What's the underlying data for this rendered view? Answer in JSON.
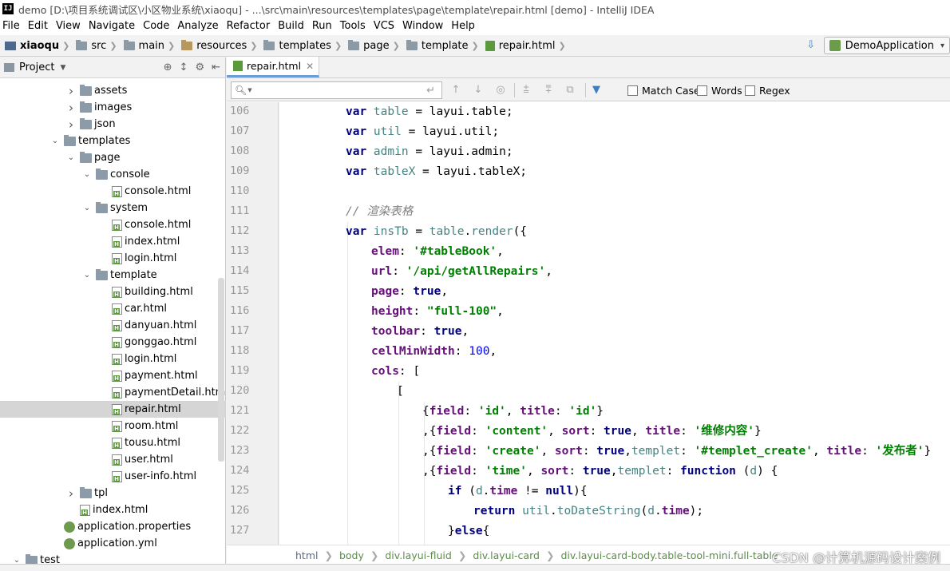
{
  "window": {
    "title": "demo [D:\\项目系统调试区\\小区物业系统\\xiaoqu] - ...\\src\\main\\resources\\templates\\page\\template\\repair.html [demo] - IntelliJ IDEA",
    "app_icon_text": "IJ"
  },
  "menu": [
    "File",
    "Edit",
    "View",
    "Navigate",
    "Code",
    "Analyze",
    "Refactor",
    "Build",
    "Run",
    "Tools",
    "VCS",
    "Window",
    "Help"
  ],
  "breadcrumb": [
    "xiaoqu",
    "src",
    "main",
    "resources",
    "templates",
    "page",
    "template",
    "repair.html"
  ],
  "run_config": "DemoApplication",
  "project_panel": {
    "title": "Project",
    "tree": [
      {
        "label": "assets",
        "depth": 5,
        "kind": "dir",
        "toggle": "closed"
      },
      {
        "label": "images",
        "depth": 5,
        "kind": "dir",
        "toggle": "closed"
      },
      {
        "label": "json",
        "depth": 5,
        "kind": "dir",
        "toggle": "closed"
      },
      {
        "label": "templates",
        "depth": 4,
        "kind": "dir",
        "toggle": "open"
      },
      {
        "label": "page",
        "depth": 5,
        "kind": "dir",
        "toggle": "open"
      },
      {
        "label": "console",
        "depth": 6,
        "kind": "dir",
        "toggle": "open"
      },
      {
        "label": "console.html",
        "depth": 7,
        "kind": "file",
        "toggle": ""
      },
      {
        "label": "system",
        "depth": 6,
        "kind": "dir",
        "toggle": "open"
      },
      {
        "label": "console.html",
        "depth": 7,
        "kind": "file",
        "toggle": ""
      },
      {
        "label": "index.html",
        "depth": 7,
        "kind": "file",
        "toggle": ""
      },
      {
        "label": "login.html",
        "depth": 7,
        "kind": "file",
        "toggle": ""
      },
      {
        "label": "template",
        "depth": 6,
        "kind": "dir",
        "toggle": "open"
      },
      {
        "label": "building.html",
        "depth": 7,
        "kind": "file",
        "toggle": ""
      },
      {
        "label": "car.html",
        "depth": 7,
        "kind": "file",
        "toggle": ""
      },
      {
        "label": "danyuan.html",
        "depth": 7,
        "kind": "file",
        "toggle": ""
      },
      {
        "label": "gonggao.html",
        "depth": 7,
        "kind": "file",
        "toggle": ""
      },
      {
        "label": "login.html",
        "depth": 7,
        "kind": "file",
        "toggle": ""
      },
      {
        "label": "payment.html",
        "depth": 7,
        "kind": "file",
        "toggle": ""
      },
      {
        "label": "paymentDetail.htm",
        "depth": 7,
        "kind": "file",
        "toggle": ""
      },
      {
        "label": "repair.html",
        "depth": 7,
        "kind": "file",
        "toggle": "",
        "selected": true
      },
      {
        "label": "room.html",
        "depth": 7,
        "kind": "file",
        "toggle": ""
      },
      {
        "label": "tousu.html",
        "depth": 7,
        "kind": "file",
        "toggle": ""
      },
      {
        "label": "user.html",
        "depth": 7,
        "kind": "file",
        "toggle": ""
      },
      {
        "label": "user-info.html",
        "depth": 7,
        "kind": "file",
        "toggle": ""
      },
      {
        "label": "tpl",
        "depth": 5,
        "kind": "dir",
        "toggle": "closed"
      },
      {
        "label": "index.html",
        "depth": 5,
        "kind": "file",
        "toggle": ""
      },
      {
        "label": "application.properties",
        "depth": 4,
        "kind": "prop",
        "toggle": ""
      },
      {
        "label": "application.yml",
        "depth": 4,
        "kind": "prop",
        "toggle": ""
      },
      {
        "label": "test",
        "depth": 2,
        "kind": "dir",
        "toggle": "open"
      }
    ]
  },
  "editor": {
    "tab": "repair.html",
    "find": {
      "placeholder": "",
      "match_case": "Match Case",
      "words": "Words",
      "regex": "Regex"
    },
    "lines": [
      {
        "n": "106",
        "fold": false
      },
      {
        "n": "107",
        "fold": false
      },
      {
        "n": "108",
        "fold": false
      },
      {
        "n": "109",
        "fold": false
      },
      {
        "n": "110",
        "fold": false
      },
      {
        "n": "111",
        "fold": false
      },
      {
        "n": "112",
        "fold": true
      },
      {
        "n": "113",
        "fold": false
      },
      {
        "n": "114",
        "fold": false
      },
      {
        "n": "115",
        "fold": false
      },
      {
        "n": "116",
        "fold": false
      },
      {
        "n": "117",
        "fold": false
      },
      {
        "n": "118",
        "fold": false
      },
      {
        "n": "119",
        "fold": true
      },
      {
        "n": "120",
        "fold": true
      },
      {
        "n": "121",
        "fold": false
      },
      {
        "n": "122",
        "fold": false
      },
      {
        "n": "123",
        "fold": false
      },
      {
        "n": "124",
        "fold": true
      },
      {
        "n": "125",
        "fold": true
      },
      {
        "n": "126",
        "fold": false
      },
      {
        "n": "127",
        "fold": true
      }
    ],
    "code_text": {
      "l106": [
        "var",
        " table",
        " = ",
        "layui",
        ".",
        "table",
        ";"
      ],
      "l107": [
        "var",
        " util",
        " = ",
        "layui",
        ".",
        "util",
        ";"
      ],
      "l108": [
        "var",
        " admin",
        " = ",
        "layui",
        ".",
        "admin",
        ";"
      ],
      "l109": [
        "var",
        " tableX",
        " = ",
        "layui",
        ".",
        "tableX",
        ";"
      ],
      "l111": "// 渲染表格",
      "l112": [
        "var",
        " insTb",
        " = ",
        "table",
        ".",
        "render",
        "({"
      ],
      "l113": [
        "elem",
        ": ",
        "'#tableBook'",
        ","
      ],
      "l114": [
        "url",
        ": ",
        "'/api/getAllRepairs'",
        ","
      ],
      "l115": [
        "page",
        ": ",
        "true",
        ","
      ],
      "l116": [
        "height",
        ": ",
        "\"full-100\"",
        ","
      ],
      "l117": [
        "toolbar",
        ": ",
        "true",
        ","
      ],
      "l118": [
        "cellMinWidth",
        ": ",
        "100",
        ","
      ],
      "l119": [
        "cols",
        ": ["
      ],
      "l120": "[",
      "l121": [
        "{",
        "field",
        ": ",
        "'id'",
        ", ",
        "title",
        ": ",
        "'id'",
        "}"
      ],
      "l122": [
        ",{",
        "field",
        ": ",
        "'content'",
        ", ",
        "sort",
        ": ",
        "true",
        ", ",
        "title",
        ": ",
        "'维修内容'",
        "}"
      ],
      "l123": [
        ",{",
        "field",
        ": ",
        "'create'",
        ", ",
        "sort",
        ": ",
        "true",
        ",",
        "templet",
        ": ",
        "'#templet_create'",
        ", ",
        "title",
        ": ",
        "'发布者'",
        "}"
      ],
      "l124": [
        ",{",
        "field",
        ": ",
        "'time'",
        ", ",
        "sort",
        ": ",
        "true",
        ",",
        "templet",
        ": ",
        "function",
        " (",
        "d",
        ") {"
      ],
      "l125": [
        "if",
        " (",
        "d",
        ".",
        "time",
        " != ",
        "null",
        "){"
      ],
      "l126": [
        "return",
        " util",
        ".",
        "toDateString",
        "(",
        "d",
        ".",
        "time",
        ");"
      ],
      "l127": [
        "}",
        "else",
        "{"
      ]
    },
    "crumbs": [
      "html",
      "body",
      "div.layui-fluid",
      "div.layui-card",
      "div.layui-card-body.table-tool-mini.full-table"
    ]
  },
  "watermark": "CSDN @计算机源码设计案例",
  "colors": {
    "keyword": "#000080",
    "string": "#008000",
    "number": "#0000ff",
    "comment": "#808080",
    "property": "#660e7a",
    "selection": "#d5d5d5"
  }
}
